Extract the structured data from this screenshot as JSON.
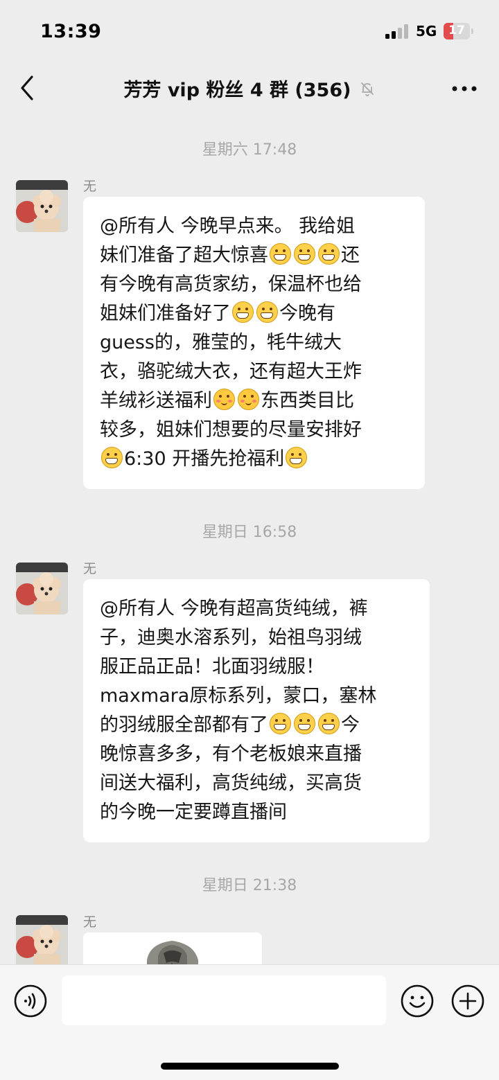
{
  "status_bar": {
    "time": "13:39",
    "network": "5G",
    "battery": "17"
  },
  "nav": {
    "title": "芳芳 vip 粉丝 4 群 (356)",
    "back_icon": "chevron-left-icon",
    "mute_icon": "bell-off-icon",
    "more_icon": "ellipsis-icon"
  },
  "messages": [
    {
      "time": "星期六 17:48",
      "sender": "无",
      "lines": [
        [
          "@所有人 今晚早点来。 我给姐"
        ],
        [
          "妹们准备了超大惊喜",
          "grin",
          "grin",
          "grin",
          "还"
        ],
        [
          "有今晚有高货家纺，保温杯也给"
        ],
        [
          "姐妹们准备好了",
          "grin",
          "grin",
          "今晚有"
        ],
        [
          "guess的，雅莹的，牦牛绒大"
        ],
        [
          "衣，骆驼绒大衣，还有超大王炸"
        ],
        [
          "羊绒衫送福利",
          "shy",
          "shy",
          "东西类目比"
        ],
        [
          "较多，姐妹们想要的尽量安排好"
        ],
        [
          "grin",
          "6:30 开播先抢福利",
          "grin"
        ]
      ]
    },
    {
      "time": "星期日 16:58",
      "sender": "无",
      "lines": [
        [
          "@所有人 今晚有超高货纯绒，裤"
        ],
        [
          "子，迪奥水溶系列，始祖鸟羽绒"
        ],
        [
          "服正品正品！北面羽绒服！"
        ],
        [
          "maxmara原标系列，蒙口，塞林"
        ],
        [
          "的羽绒服全部都有了",
          "grin",
          "grin",
          "grin",
          "今"
        ],
        [
          "晚惊喜多多，有个老板娘来直播"
        ],
        [
          "间送大福利，高货纯绒，买高货"
        ],
        [
          "的今晚一定要蹲直播间"
        ]
      ]
    },
    {
      "time": "星期日 21:38",
      "sender": "无",
      "image_icon": "jacket-photo"
    }
  ],
  "input_bar": {
    "placeholder": "",
    "voice_icon": "voice-icon",
    "emoji_icon": "emoji-icon",
    "plus_icon": "plus-icon"
  },
  "colors": {
    "background": "#ededed",
    "bubble": "#ffffff",
    "timestamp": "#a7a7a7"
  }
}
